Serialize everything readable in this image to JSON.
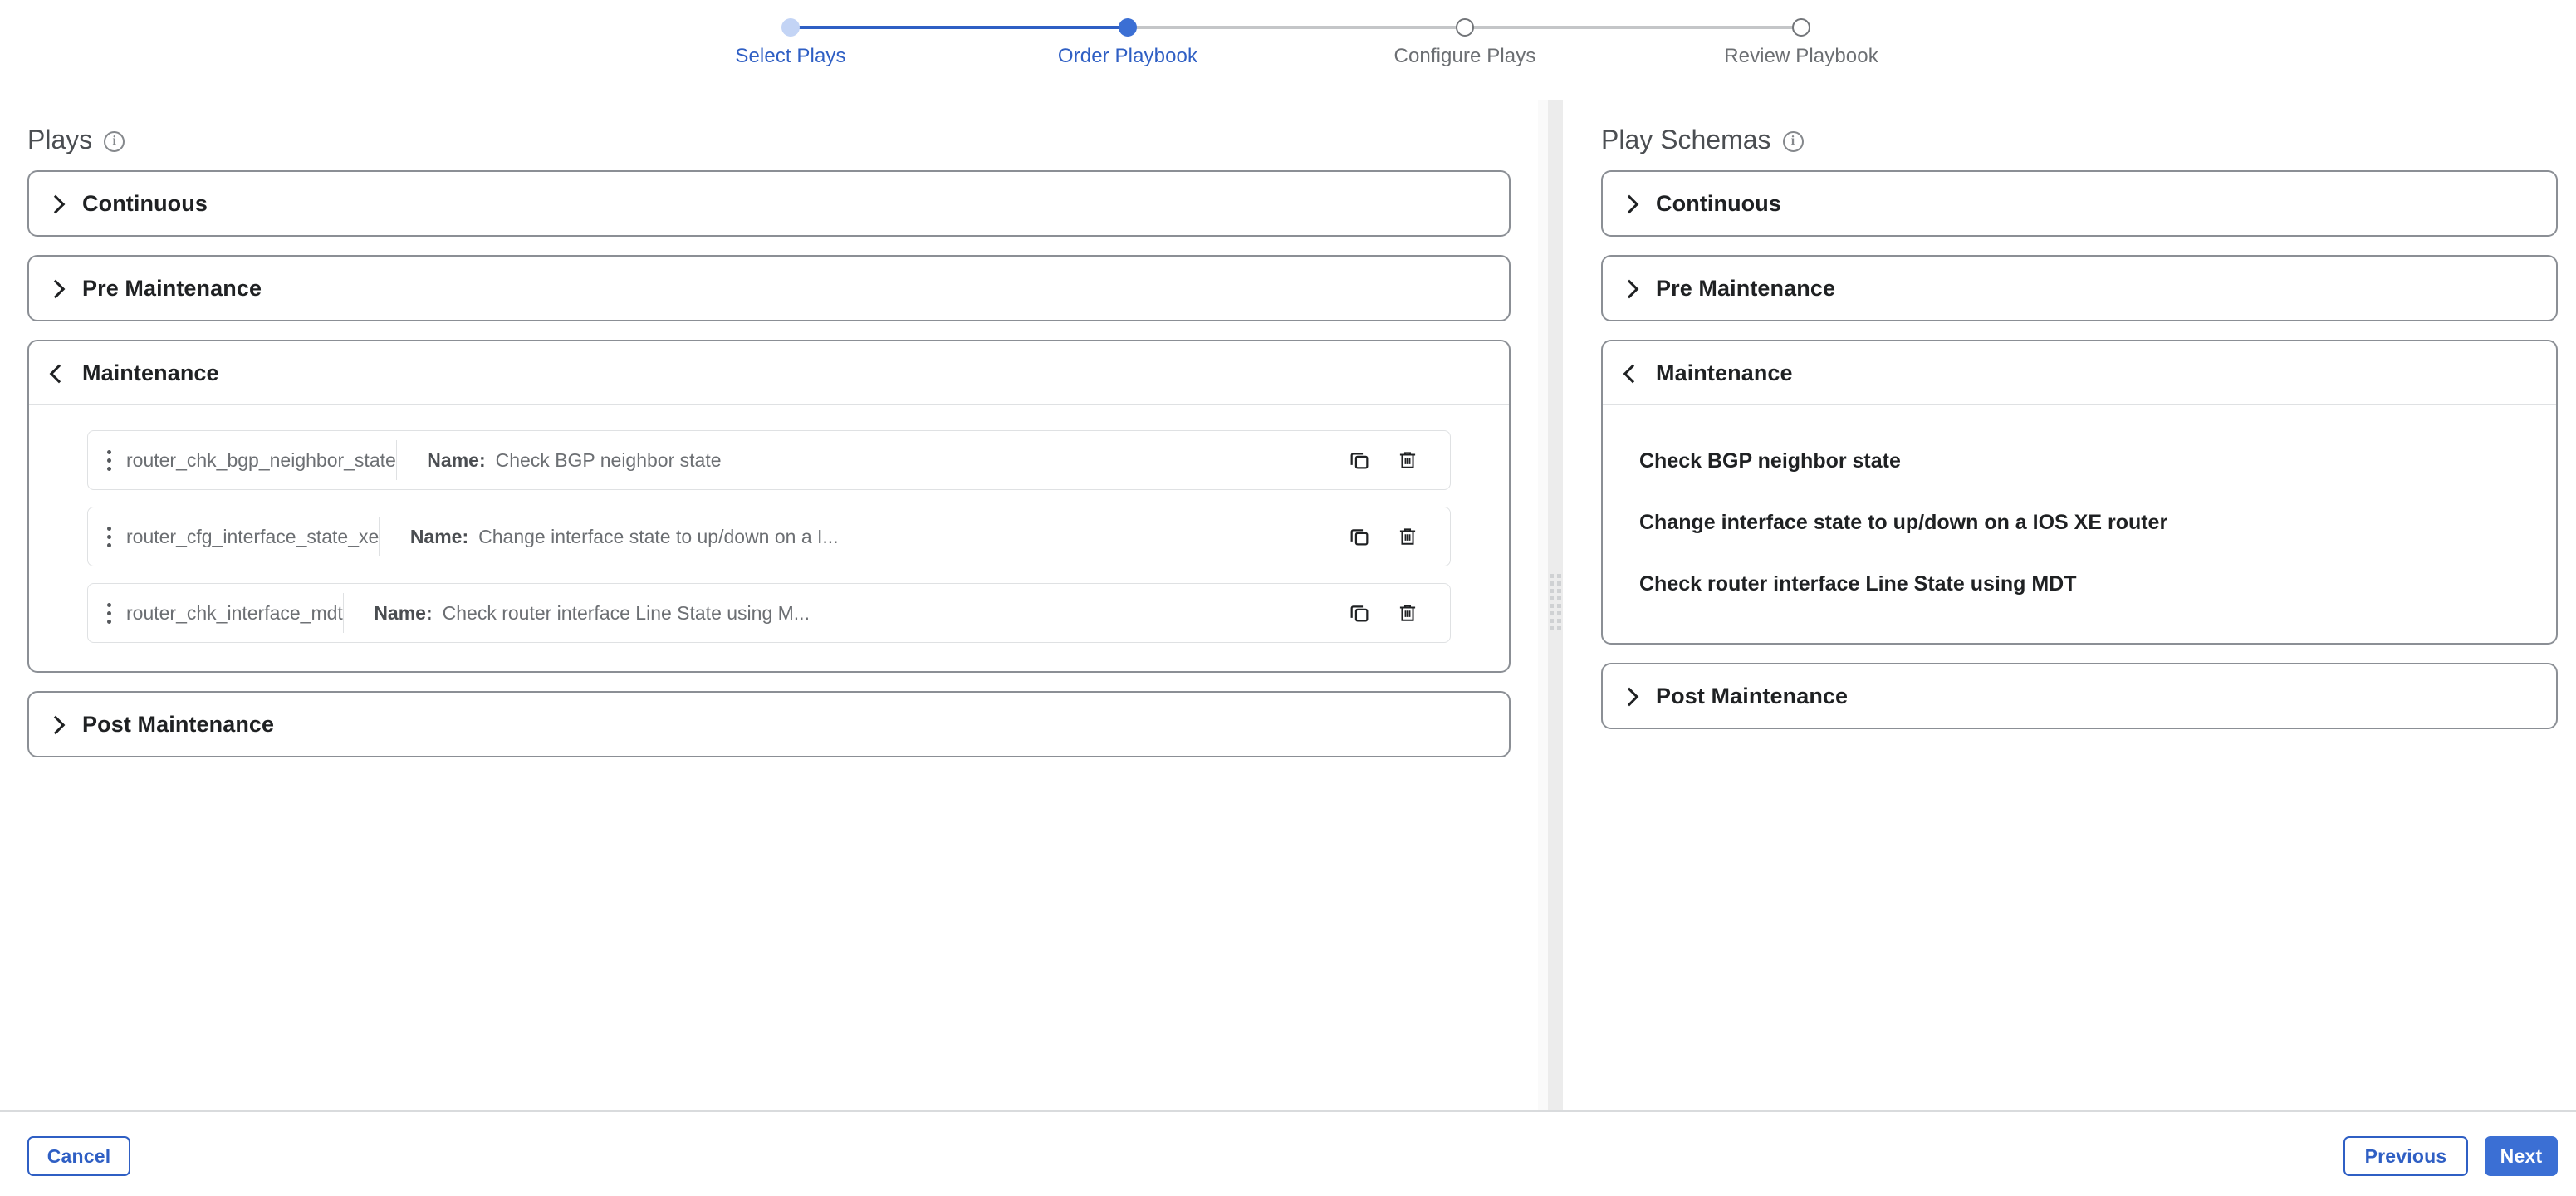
{
  "stepper": {
    "steps": [
      {
        "label": "Select Plays",
        "state": "done"
      },
      {
        "label": "Order Playbook",
        "state": "active"
      },
      {
        "label": "Configure Plays",
        "state": "todo"
      },
      {
        "label": "Review Playbook",
        "state": "todo"
      }
    ],
    "active_color": "#3b6fd4",
    "done_color": "#c3d4f5",
    "track_color": "#c4c6c8",
    "track_done_color": "#2f5fc4",
    "label_active_color": "#2f5fc4",
    "label_todo_color": "#6c6f73"
  },
  "plays_panel": {
    "title": "Plays",
    "info_icon": "info-icon",
    "groups": [
      {
        "title": "Continuous",
        "expanded": false,
        "chevron": "chevron-right-icon",
        "plays": []
      },
      {
        "title": "Pre Maintenance",
        "expanded": false,
        "chevron": "chevron-right-icon",
        "plays": []
      },
      {
        "title": "Maintenance",
        "expanded": true,
        "chevron": "chevron-left-icon",
        "plays": [
          {
            "drag_handle": "drag-handle-icon",
            "id": "router_chk_bgp_neighbor_state",
            "name_label": "Name:",
            "name_value": "Check BGP neighbor state",
            "copy_icon": "copy-icon",
            "delete_icon": "trash-icon"
          },
          {
            "drag_handle": "drag-handle-icon",
            "id": "router_cfg_interface_state_xe",
            "name_label": "Name:",
            "name_value": "Change interface state to up/down on a I...",
            "copy_icon": "copy-icon",
            "delete_icon": "trash-icon"
          },
          {
            "drag_handle": "drag-handle-icon",
            "id": "router_chk_interface_mdt",
            "name_label": "Name:",
            "name_value": "Check router interface Line State using M...",
            "copy_icon": "copy-icon",
            "delete_icon": "trash-icon"
          }
        ]
      },
      {
        "title": "Post Maintenance",
        "expanded": false,
        "chevron": "chevron-right-icon",
        "plays": []
      }
    ]
  },
  "schemas_panel": {
    "title": "Play Schemas",
    "info_icon": "info-icon",
    "groups": [
      {
        "title": "Continuous",
        "expanded": false,
        "chevron": "chevron-right-icon",
        "items": []
      },
      {
        "title": "Pre Maintenance",
        "expanded": false,
        "chevron": "chevron-right-icon",
        "items": []
      },
      {
        "title": "Maintenance",
        "expanded": true,
        "chevron": "chevron-left-icon",
        "items": [
          "Check BGP neighbor state",
          "Change interface state to up/down on a IOS XE router",
          "Check router interface Line State using MDT"
        ]
      },
      {
        "title": "Post Maintenance",
        "expanded": false,
        "chevron": "chevron-right-icon",
        "items": []
      }
    ]
  },
  "splitter": {
    "grip_icon": "splitter-grip-icon"
  },
  "footer": {
    "cancel_label": "Cancel",
    "previous_label": "Previous",
    "next_label": "Next",
    "primary_color": "#3b6fd4",
    "outline_color": "#2f5fc4"
  }
}
